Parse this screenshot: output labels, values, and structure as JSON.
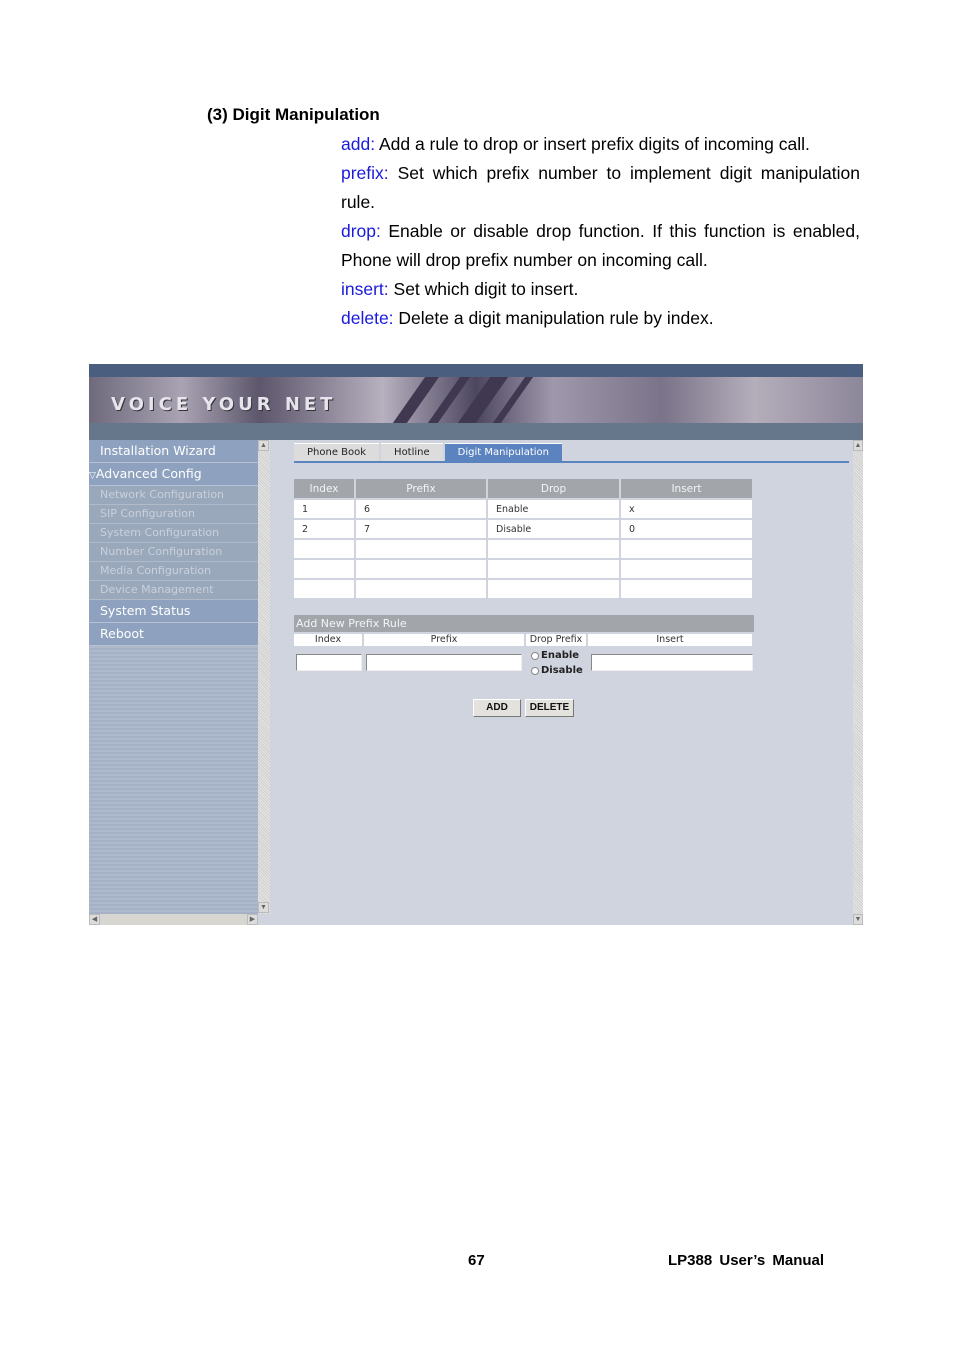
{
  "doc": {
    "section_title": "(3) Digit Manipulation",
    "items": [
      {
        "term": "add:",
        "text": " Add a rule to drop or insert prefix digits of incoming call."
      },
      {
        "term": "prefix:",
        "text": " Set which prefix number to implement digit manipulation rule."
      },
      {
        "term": "drop:",
        "text": " Enable or disable drop function. If this function is enabled, Phone will drop prefix number on incoming call."
      },
      {
        "term": "insert:",
        "text": " Set which digit to insert."
      },
      {
        "term": "delete:",
        "text": " Delete a digit manipulation rule by index."
      }
    ],
    "footer": {
      "page_number": "67",
      "manual_title": "LP388 User’s Manual"
    }
  },
  "app": {
    "banner_text": "VOICE YOUR NET",
    "colors": {
      "accent": "#5b83c0",
      "nav": "#8ea2bf",
      "header_gray": "#a2a6ab",
      "content_bg": "#d0d4de",
      "term_blue": "#1a1adb"
    },
    "sidebar": {
      "items": [
        {
          "label": "Installation Wizard",
          "type": "main"
        },
        {
          "label": "Advanced Config",
          "type": "main",
          "expanded": true
        },
        {
          "label": "Network Configuration",
          "type": "sub"
        },
        {
          "label": "SIP Configuration",
          "type": "sub"
        },
        {
          "label": "System Configuration",
          "type": "sub"
        },
        {
          "label": "Number Configuration",
          "type": "sub"
        },
        {
          "label": "Media Configuration",
          "type": "sub"
        },
        {
          "label": "Device Management",
          "type": "sub"
        },
        {
          "label": "System Status",
          "type": "main"
        },
        {
          "label": "Reboot",
          "type": "main"
        }
      ]
    },
    "tabs": [
      {
        "label": "Phone Book",
        "active": false
      },
      {
        "label": "Hotline",
        "active": false
      },
      {
        "label": "Digit Manipulation",
        "active": true
      }
    ],
    "rules_table": {
      "headers": [
        "Index",
        "Prefix",
        "Drop",
        "Insert"
      ],
      "rows": [
        [
          "1",
          "6",
          "Enable",
          "x"
        ],
        [
          "2",
          "7",
          "Disable",
          "0"
        ],
        [
          "",
          "",
          "",
          ""
        ],
        [
          "",
          "",
          "",
          ""
        ],
        [
          "",
          "",
          "",
          ""
        ]
      ]
    },
    "add_form": {
      "title": "Add New Prefix Rule",
      "columns": [
        "Index",
        "Prefix",
        "Drop Prefix",
        "Insert"
      ],
      "index_value": "",
      "prefix_value": "",
      "insert_value": "",
      "radio_enable": "Enable",
      "radio_disable": "Disable"
    },
    "buttons": {
      "add": "ADD",
      "delete": "DELETE"
    }
  }
}
